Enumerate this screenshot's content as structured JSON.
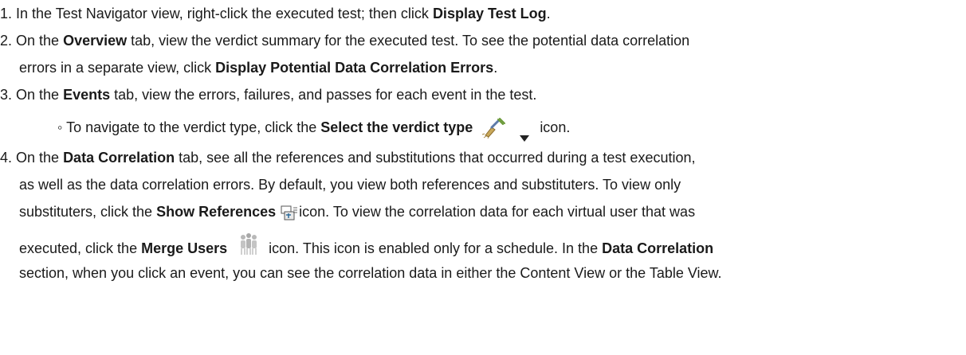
{
  "steps": [
    {
      "num": "1.",
      "pre": " In the Test Navigator view, right-click the executed test; then click ",
      "bold1": "Display Test Log",
      "post": "."
    },
    {
      "num": "2.",
      "pre": " On the ",
      "bold1": "Overview",
      "mid1": " tab, view the verdict summary for the executed test. To see the potential data correlation",
      "line2_pre": "errors in a separate view, click ",
      "bold2": "Display Potential Data Correlation Errors",
      "line2_post": "."
    },
    {
      "num": "3.",
      "pre": " On the ",
      "bold1": "Events",
      "post": " tab, view the errors, failures, and passes for each event in the test.",
      "sub_bullet": "◦",
      "sub_pre": " To navigate to the verdict type, click the ",
      "sub_bold": "Select the verdict type",
      "sub_post": "icon."
    },
    {
      "num": "4.",
      "pre": " On the ",
      "bold1": "Data Correlation",
      "post": " tab, see all the references and substitutions that occurred during a test execution,",
      "line2": "as well as the data correlation errors. By default, you view both references and substituters. To view only",
      "line3_pre": "substituters, click the ",
      "line3_bold": "Show References",
      "line3_post": "icon. To view the correlation data for each virtual user that was",
      "line4_pre": "executed, click the ",
      "line4_bold": "Merge Users",
      "line4_mid": "icon. This icon is enabled only for a schedule. In the ",
      "line4_bold2": "Data Correlation",
      "line5": "section, when you click an event, you can see the correlation data in either the Content View or the Table View."
    }
  ],
  "icons": {
    "verdict": "select-verdict-type-icon",
    "dropdown": "dropdown-arrow-icon",
    "refs": "show-references-icon",
    "merge": "merge-users-icon"
  }
}
